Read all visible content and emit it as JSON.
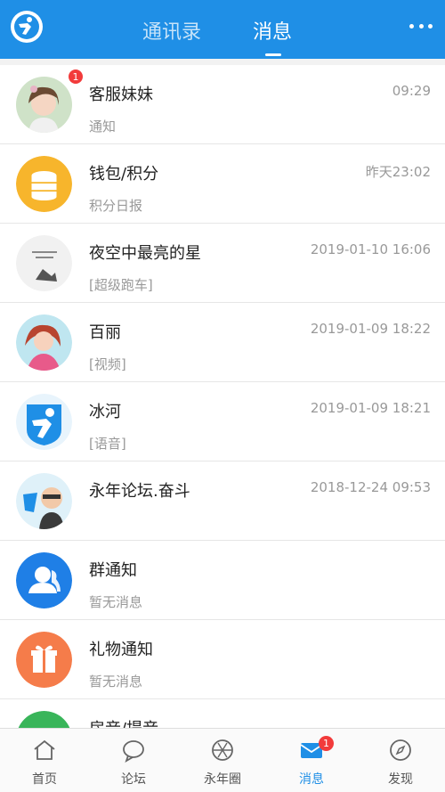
{
  "header": {
    "tabs": [
      {
        "label": "通讯录"
      },
      {
        "label": "消息"
      }
    ]
  },
  "conversations": [
    {
      "name": "客服妹妹",
      "subtitle": "通知",
      "time": "09:29",
      "badge": "1"
    },
    {
      "name": "钱包/积分",
      "subtitle": "积分日报",
      "time": "昨天23:02"
    },
    {
      "name": "夜空中最亮的星",
      "subtitle": "[超级跑车]",
      "time": "2019-01-10 16:06"
    },
    {
      "name": "百丽",
      "subtitle": "[视频]",
      "time": "2019-01-09 18:22"
    },
    {
      "name": "冰河",
      "subtitle": "[语音]",
      "time": "2019-01-09 18:21"
    },
    {
      "name": "永年论坛.奋斗",
      "subtitle": "",
      "time": "2018-12-24 09:53"
    },
    {
      "name": "群通知",
      "subtitle": "暂无消息",
      "time": ""
    },
    {
      "name": "礼物通知",
      "subtitle": "暂无消息",
      "time": ""
    },
    {
      "name": "房音/提音",
      "subtitle": "",
      "time": ""
    }
  ],
  "bottom_nav": [
    {
      "label": "首页"
    },
    {
      "label": "论坛"
    },
    {
      "label": "永年圈"
    },
    {
      "label": "消息",
      "badge": "1"
    },
    {
      "label": "发现"
    }
  ],
  "colors": {
    "primary": "#1f8fe6",
    "badge": "#f23b3b",
    "wallet": "#f7b52c",
    "group": "#1f7fe6",
    "gift": "#f57c4a",
    "green": "#39b55a"
  }
}
